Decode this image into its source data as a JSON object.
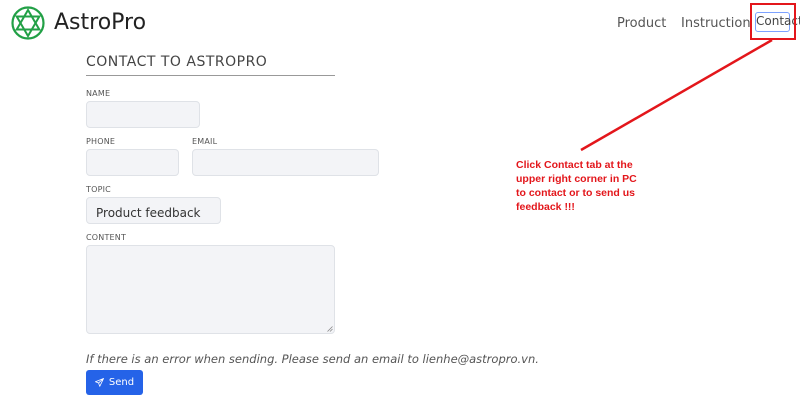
{
  "header": {
    "brand": "AstroPro",
    "nav": {
      "product": "Product",
      "instruction": "Instruction",
      "contact": "Contact"
    }
  },
  "form": {
    "title": "CONTACT TO ASTROPRO",
    "name_label": "NAME",
    "name_value": "",
    "phone_label": "PHONE",
    "phone_value": "",
    "email_label": "EMAIL",
    "email_value": "",
    "topic_label": "TOPIC",
    "topic_value": "Product feedback",
    "content_label": "CONTENT",
    "content_value": "",
    "note": "If there is an error when sending. Please send an email to lienhe@astropro.vn.",
    "send_label": "Send"
  },
  "annotation": {
    "text_lines": [
      "Click Contact tab at the",
      "upper right corner in PC",
      "to contact or to send us",
      "feedback !!!"
    ]
  },
  "colors": {
    "brand_green": "#22a046",
    "send_blue": "#2563e8",
    "annotation_red": "#e3161b"
  },
  "icons": {
    "logo": "hexagram-star-icon",
    "send": "paper-plane-icon"
  }
}
